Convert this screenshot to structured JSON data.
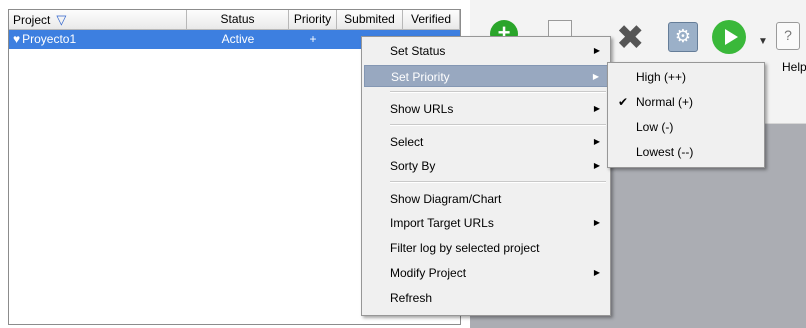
{
  "grid": {
    "columns": [
      "Project",
      "Status",
      "Priority",
      "Submited",
      "Verified"
    ],
    "row": {
      "project": "Proyecto1",
      "status": "Active",
      "priority": "+"
    }
  },
  "toolbar": {
    "add_icon_glyph": "+",
    "delete_icon_glyph": "✖",
    "config_icon_glyph": "⚙",
    "dropdown_glyph": "▼",
    "help_icon_glyph": "?",
    "help_label": "Help"
  },
  "context_menu": {
    "items": [
      {
        "label": "Set Status",
        "submenu": true
      },
      {
        "label": "Set Priority",
        "submenu": true,
        "highlighted": true
      },
      {
        "label": "Show URLs",
        "submenu": true
      },
      {
        "label": "Select",
        "submenu": true
      },
      {
        "label": "Sorty By",
        "submenu": true
      },
      {
        "label": "Show Diagram/Chart",
        "submenu": false
      },
      {
        "label": "Import Target URLs",
        "submenu": true
      },
      {
        "label": "Filter log by selected project",
        "submenu": false
      },
      {
        "label": "Modify Project",
        "submenu": true
      },
      {
        "label": "Refresh",
        "submenu": false
      }
    ],
    "arrow_glyph": "▶"
  },
  "priority_submenu": {
    "items": [
      {
        "label": "High (++)",
        "checked": false
      },
      {
        "label": "Normal (+)",
        "checked": true
      },
      {
        "label": "Low (-)",
        "checked": false
      },
      {
        "label": "Lowest (--)",
        "checked": false
      }
    ],
    "check_glyph": "✔"
  },
  "colors": {
    "selection": "#3d7fe0",
    "menu_highlight": "#98a8c0",
    "menu_background": "#f0f0f0"
  }
}
